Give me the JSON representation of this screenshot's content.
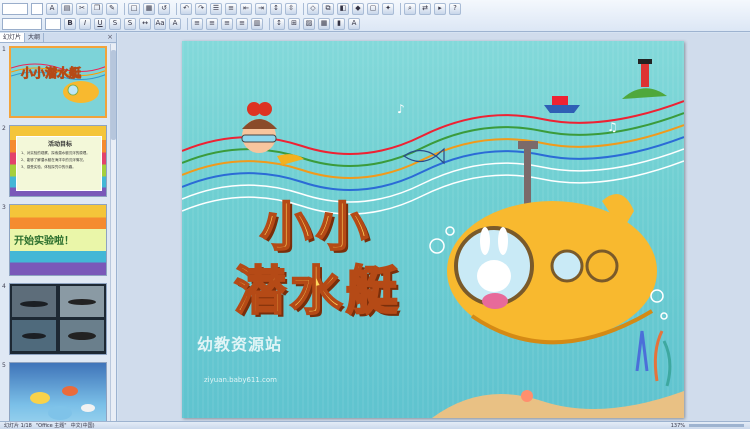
{
  "panel": {
    "tab_slides": "幻灯片",
    "tab_outline": "大纲",
    "close": "×"
  },
  "thumbnails": [
    {
      "num": "1",
      "title": "小小潜水艇"
    },
    {
      "num": "2",
      "title": "活动目标",
      "lines": [
        "1、对实验的观察，探索潜水艇沉浮的原理。",
        "2、能够了解潜水艇在海洋中的沉浮情况。",
        "3、感受实验、体验探究中的乐趣。"
      ]
    },
    {
      "num": "3",
      "title": "开始实验啦！"
    },
    {
      "num": "4"
    },
    {
      "num": "5"
    }
  ],
  "slide": {
    "title_line1": "小小",
    "title_line2": "潜水艇",
    "watermark": "幼教资源站",
    "watermark_url": "ziyuan.baby611.com"
  },
  "statusbar": {
    "slide_info": "幻灯片 1/18",
    "theme": "\"Office 主题\"",
    "language": "中文(中国)",
    "zoom": "137%"
  },
  "colors": {
    "sea": "#7fd6d7",
    "title_fill": "#ffd75e",
    "title_stroke": "#b54a16",
    "submarine": "#f8b92f"
  }
}
